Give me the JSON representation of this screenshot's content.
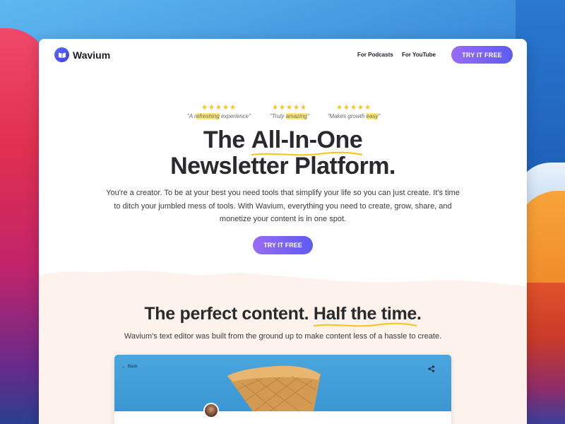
{
  "colors": {
    "brand": "#5e5bf0",
    "cta_gradient_start": "#9a6cf3",
    "star": "#f5c518",
    "highlight": "#fbe77a",
    "squiggle": "#f5c518",
    "cream": "#fdf3ec"
  },
  "nav": {
    "logo_icon": "book-open-icon",
    "logo_text": "Wavium",
    "links": [
      "For Podcasts",
      "For YouTube"
    ],
    "cta": "TRY IT FREE"
  },
  "reviews": [
    {
      "stars": "★★★★★",
      "pre": "\"A r",
      "hl": "efreshing",
      "post": " experience\""
    },
    {
      "stars": "★★★★★",
      "pre": "\"Truly ",
      "hl": "amazing",
      "post": "\""
    },
    {
      "stars": "★★★★★",
      "pre": "\"Makes growth ",
      "hl": "easy",
      "post": "\""
    }
  ],
  "hero": {
    "title_pre": "The ",
    "title_em": "All-In-One",
    "title_line2": "Newsletter Platform.",
    "subtitle": "You're a creator. To be at your best you need tools that simplify your life so you can just create. It's time to ditch your jumbled mess of tools. With Wavium, everything you need to create, grow, share, and monetize your content is in one spot.",
    "cta": "TRY IT FREE"
  },
  "section": {
    "title_pre": "The perfect content. ",
    "title_em": "Half the time",
    "title_post": ".",
    "subtitle": "Wavium's text editor was built from the ground up to make content less of a hassle to create."
  },
  "preview": {
    "back_label": "Back",
    "back_icon": "arrow-left-icon",
    "share_icon": "share-icon"
  }
}
